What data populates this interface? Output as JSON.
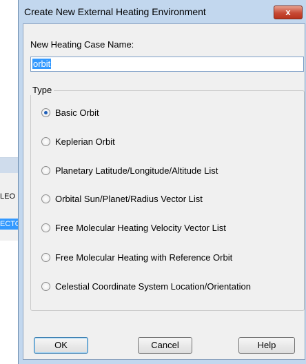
{
  "background_window": {
    "rows": [
      "LEO",
      "ECTO"
    ]
  },
  "dialog": {
    "title": "Create New External Heating Environment",
    "close_label": "x",
    "name_label": "New Heating Case Name:",
    "name_value": "orbit",
    "type_label": "Type",
    "options": [
      {
        "label": "Basic Orbit",
        "checked": true
      },
      {
        "label": "Keplerian Orbit",
        "checked": false
      },
      {
        "label": "Planetary Latitude/Longitude/Altitude List",
        "checked": false
      },
      {
        "label": "Orbital Sun/Planet/Radius Vector List",
        "checked": false
      },
      {
        "label": "Free Molecular Heating Velocity Vector List",
        "checked": false
      },
      {
        "label": "Free Molecular Heating with Reference Orbit",
        "checked": false
      },
      {
        "label": "Celestial Coordinate System Location/Orientation",
        "checked": false
      }
    ],
    "buttons": {
      "ok": "OK",
      "cancel": "Cancel",
      "help": "Help"
    }
  }
}
